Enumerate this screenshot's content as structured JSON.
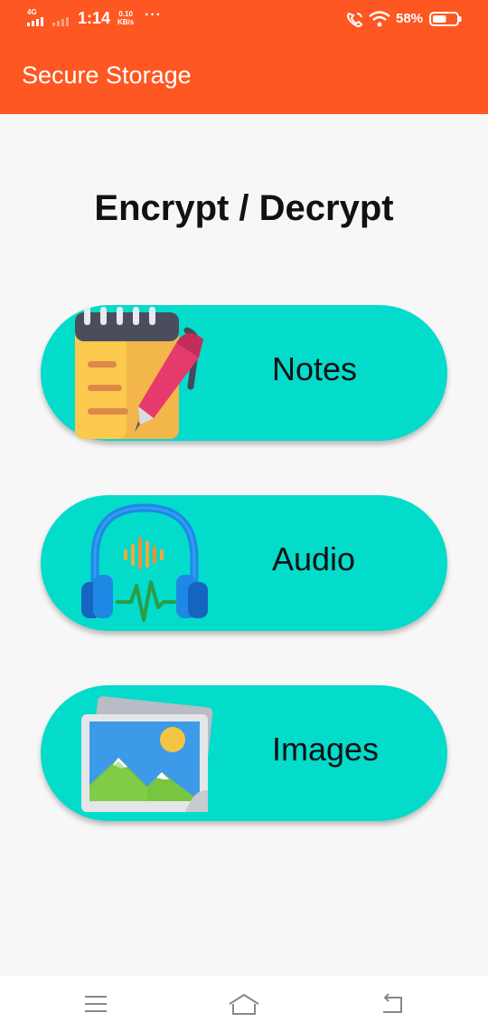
{
  "status_bar": {
    "network": "4G",
    "time": "1:14",
    "speed_value": "0.10",
    "speed_unit": "KB/s",
    "more": "···",
    "battery": "58%",
    "battery_level": 0.58
  },
  "app_bar": {
    "title": "Secure Storage",
    "color": "#fe5722"
  },
  "main": {
    "heading": "Encrypt / Decrypt",
    "card_color": "#03dbcb",
    "cards": [
      {
        "label": "Notes",
        "icon": "notepad-pen-icon"
      },
      {
        "label": "Audio",
        "icon": "headphones-icon"
      },
      {
        "label": "Images",
        "icon": "image-gallery-icon"
      }
    ]
  },
  "nav_bar": {
    "items": [
      {
        "icon": "menu-icon"
      },
      {
        "icon": "home-icon"
      },
      {
        "icon": "back-icon"
      }
    ]
  }
}
